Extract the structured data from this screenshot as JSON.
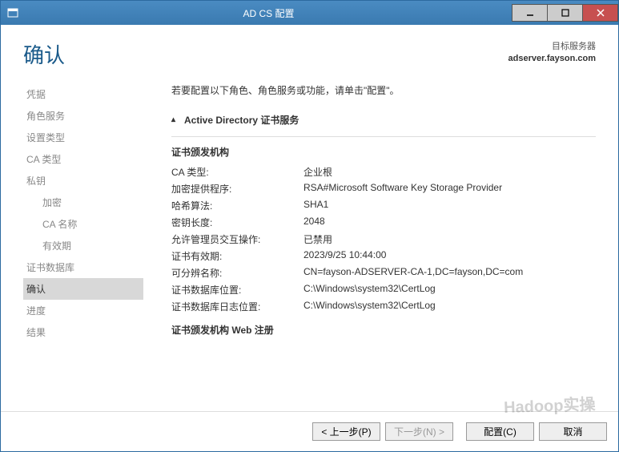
{
  "window": {
    "title": "AD CS 配置"
  },
  "header": {
    "page_title": "确认",
    "target_label": "目标服务器",
    "target_server": "adserver.fayson.com"
  },
  "sidebar": {
    "items": [
      {
        "label": "凭据",
        "child": false,
        "selected": false
      },
      {
        "label": "角色服务",
        "child": false,
        "selected": false
      },
      {
        "label": "设置类型",
        "child": false,
        "selected": false
      },
      {
        "label": "CA 类型",
        "child": false,
        "selected": false
      },
      {
        "label": "私钥",
        "child": false,
        "selected": false
      },
      {
        "label": "加密",
        "child": true,
        "selected": false
      },
      {
        "label": "CA 名称",
        "child": true,
        "selected": false
      },
      {
        "label": "有效期",
        "child": true,
        "selected": false
      },
      {
        "label": "证书数据库",
        "child": false,
        "selected": false
      },
      {
        "label": "确认",
        "child": false,
        "selected": true
      },
      {
        "label": "进度",
        "child": false,
        "selected": false
      },
      {
        "label": "结果",
        "child": false,
        "selected": false
      }
    ]
  },
  "details": {
    "hint": "若要配置以下角色、角色服务或功能，请单击\"配置\"。",
    "section_title": "Active Directory 证书服务",
    "group1_title": "证书颁发机构",
    "rows": [
      {
        "k": "CA 类型:",
        "v": "企业根"
      },
      {
        "k": "加密提供程序:",
        "v": "RSA#Microsoft Software Key Storage Provider"
      },
      {
        "k": "哈希算法:",
        "v": "SHA1"
      },
      {
        "k": "密钥长度:",
        "v": "2048"
      },
      {
        "k": "允许管理员交互操作:",
        "v": "已禁用"
      },
      {
        "k": "证书有效期:",
        "v": "2023/9/25 10:44:00"
      },
      {
        "k": "可分辨名称:",
        "v": "CN=fayson-ADSERVER-CA-1,DC=fayson,DC=com"
      },
      {
        "k": "证书数据库位置:",
        "v": "C:\\Windows\\system32\\CertLog"
      },
      {
        "k": "证书数据库日志位置:",
        "v": "C:\\Windows\\system32\\CertLog"
      }
    ],
    "group2_title": "证书颁发机构 Web 注册"
  },
  "footer": {
    "prev": "< 上一步(P)",
    "next": "下一步(N) >",
    "configure": "配置(C)",
    "cancel": "取消"
  },
  "watermark": "Hadoop实操"
}
